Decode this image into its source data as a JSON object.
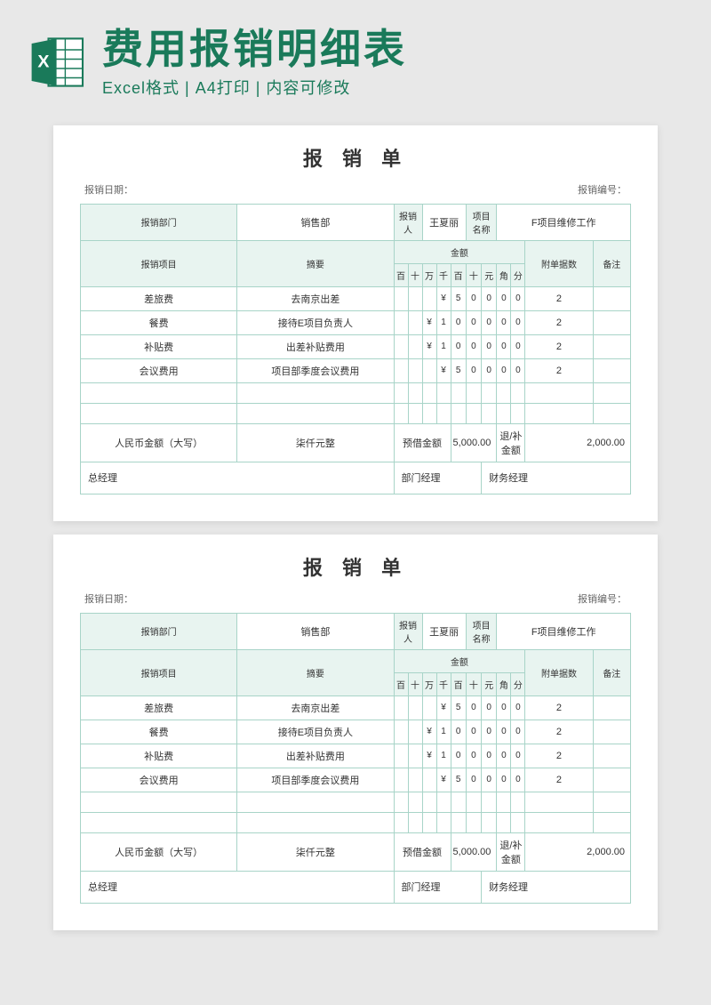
{
  "header": {
    "title": "费用报销明细表",
    "subtitle": "Excel格式 | A4打印 | 内容可修改"
  },
  "form": {
    "title": "报 销 单",
    "date_label": "报销日期：",
    "number_label": "报销编号：",
    "dept_label": "报销部门",
    "dept_value": "销售部",
    "person_label": "报销人",
    "person_value": "王夏丽",
    "project_label": "项目名称",
    "project_value": "F项目维修工作",
    "item_label": "报销项目",
    "summary_label": "摘要",
    "amount_label": "金额",
    "attach_label": "附单据数",
    "remark_label": "备注",
    "digits": [
      "百",
      "十",
      "万",
      "千",
      "百",
      "十",
      "元",
      "角",
      "分"
    ],
    "rows": [
      {
        "item": "差旅费",
        "summary": "去南京出差",
        "digits": [
          "",
          "",
          "",
          "",
          "¥",
          "5",
          "0",
          "0",
          "0",
          "0"
        ],
        "attach": "2",
        "remark": ""
      },
      {
        "item": "餐费",
        "summary": "接待E项目负责人",
        "digits": [
          "",
          "",
          "",
          "¥",
          "1",
          "0",
          "0",
          "0",
          "0",
          "0"
        ],
        "attach": "2",
        "remark": ""
      },
      {
        "item": "补贴费",
        "summary": "出差补贴费用",
        "digits": [
          "",
          "",
          "",
          "¥",
          "1",
          "0",
          "0",
          "0",
          "0",
          "0"
        ],
        "attach": "2",
        "remark": ""
      },
      {
        "item": "会议费用",
        "summary": "项目部季度会议费用",
        "digits": [
          "",
          "",
          "",
          "",
          "¥",
          "5",
          "0",
          "0",
          "0",
          "0"
        ],
        "attach": "2",
        "remark": ""
      }
    ],
    "total_label": "人民币金额（大写）",
    "total_words": "柒仟元整",
    "advance_label": "预借金额",
    "advance_value": "5,000.00",
    "refund_label": "退/补金额",
    "refund_value": "2,000.00",
    "sign_gm": "总经理",
    "sign_dm": "部门经理",
    "sign_fm": "财务经理"
  }
}
